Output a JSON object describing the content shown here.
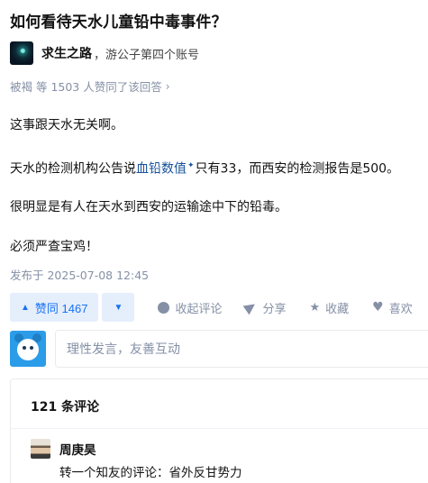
{
  "question": {
    "title": "如何看待天水儿童铅中毒事件？"
  },
  "author": {
    "name": "求生之路",
    "headline": "，游公子第四个账号"
  },
  "voters_line": "被褐 等 1503 人赞同了该回答",
  "answer": {
    "p1": "这事跟天水无关啊。",
    "p2_before": "天水的检测机构公告说",
    "p2_link": "血铅数值",
    "p2_after": "只有33，而西安的检测报告是500。",
    "p3": "很明显是有人在天水到西安的运输途中下的铅毒。",
    "p4": "必须严查宝鸡！"
  },
  "publish_time": "发布于 2025-07-08 12:45",
  "actions": {
    "vote_up_label": "赞同 1467",
    "comment_label": "收起评论",
    "share_label": "分享",
    "collect_label": "收藏",
    "like_label": "喜欢"
  },
  "comment_box": {
    "placeholder": "理性发言，友善互动"
  },
  "comments": {
    "count_label": "121 条评论",
    "items": [
      {
        "author": "周庚昊",
        "text": "转一个知友的评论：省外反甘势力"
      }
    ]
  },
  "colors": {
    "accent": "#1772f6",
    "accent_bg": "#e5eefb",
    "muted": "#8590a6",
    "link": "#175199"
  }
}
